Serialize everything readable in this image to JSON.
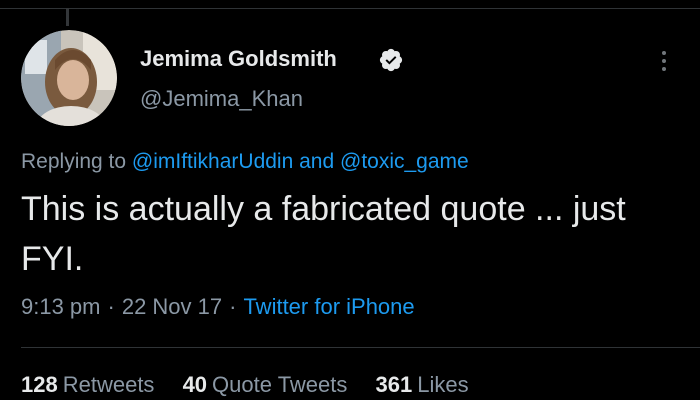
{
  "tweet": {
    "author": {
      "name": "Jemima Goldsmith",
      "handle": "@Jemima_Khan",
      "verified_icon": "verified-badge-icon",
      "verified_color": "#e7e9ea"
    },
    "more_icon": "more-options-icon",
    "replying": {
      "prefix": "Replying to ",
      "mention_1": "@imIftikharUddin",
      "conjunction": " and ",
      "mention_2": "@toxic_game"
    },
    "text": "This is actually a fabricated quote ... just FYI.",
    "meta": {
      "time": "9:13 pm",
      "date": "22 Nov 17",
      "separator": "·",
      "source": "Twitter for iPhone"
    },
    "stats": {
      "retweets_count": "128",
      "retweets_label": "Retweets",
      "quotes_count": "40",
      "quotes_label": "Quote Tweets",
      "likes_count": "361",
      "likes_label": "Likes"
    }
  },
  "colors": {
    "background": "#000000",
    "text": "#e7e9ea",
    "secondary_text": "#8b98a5",
    "link": "#1d9bf0"
  }
}
